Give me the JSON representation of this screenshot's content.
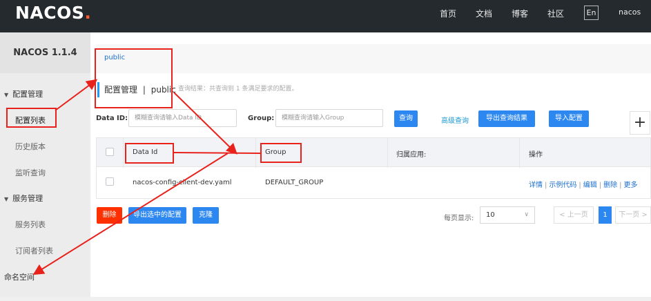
{
  "brand": {
    "logo_text": "NACOS",
    "logo_dot": "."
  },
  "topnav": {
    "items": [
      "首页",
      "文档",
      "博客",
      "社区"
    ],
    "lang": "En",
    "user": "nacos"
  },
  "sidebar": {
    "version": "NACOS 1.1.4",
    "groups": [
      {
        "label": "配置管理",
        "items": [
          "配置列表",
          "历史版本",
          "监听查询"
        ]
      },
      {
        "label": "服务管理",
        "items": [
          "服务列表",
          "订阅者列表"
        ]
      }
    ],
    "namespace": "命名空间"
  },
  "namespace_bar": {
    "current": "public"
  },
  "page": {
    "title": "配置管理",
    "title_sep": "|",
    "title_ns": "public",
    "result_text": "查询结果：共查询到 1 条满足要求的配置。"
  },
  "search": {
    "data_id_label": "Data ID:",
    "data_id_placeholder": "模糊查询请输入Data ID",
    "group_label": "Group:",
    "group_placeholder": "模糊查询请输入Group",
    "query_btn": "查询",
    "advanced_link": "高级查询",
    "export_btn": "导出查询结果",
    "import_btn": "导入配置",
    "add_btn": "+"
  },
  "table": {
    "headers": [
      "Data Id",
      "Group",
      "归属应用:",
      "操作"
    ],
    "rows": [
      {
        "data_id": "nacos-config-client-dev.yaml",
        "group": "DEFAULT_GROUP",
        "app": "",
        "ops": [
          "详情",
          "示例代码",
          "编辑",
          "删除",
          "更多"
        ]
      }
    ]
  },
  "bulk": {
    "delete_btn": "删除",
    "export_selected_btn": "导出选中的配置",
    "clone_btn": "克隆"
  },
  "pager": {
    "page_size_label": "每页显示:",
    "page_size": "10",
    "prev": "< 上一页",
    "current": "1",
    "next": "下一页 >"
  },
  "colors": {
    "primary": "#2c87f0",
    "danger": "#ff3000",
    "annotation": "#e8221b",
    "topbar": "#252a2f"
  }
}
